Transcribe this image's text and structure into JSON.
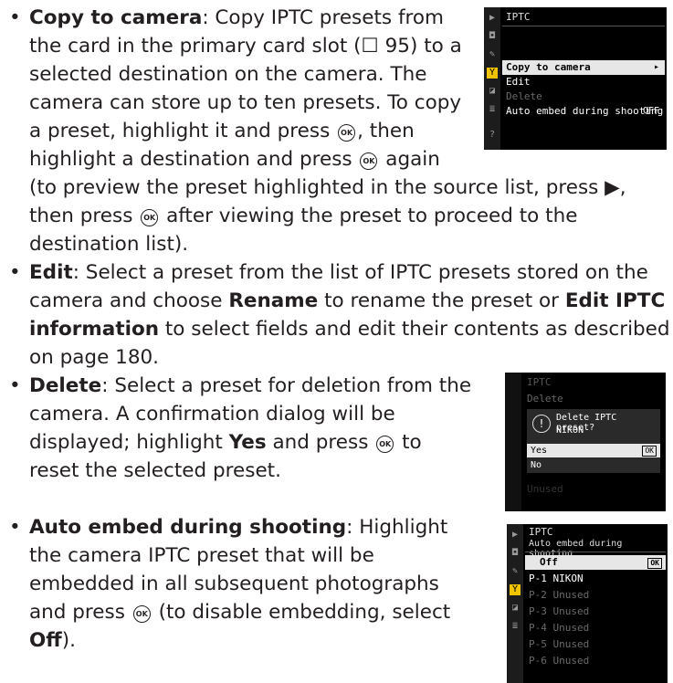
{
  "ok_glyph": "OK",
  "book_glyph": "☐",
  "item1": {
    "term": "Copy to camera",
    "lines": [
      "the card in the primary card slot (",
      " 95) to a",
      "selected destination on the camera. The",
      "camera can store up to ten presets.  To copy",
      "a preset, highlight it and press ",
      ", then",
      "highlight a destination and press ",
      " again",
      "(to preview the preset highlighted in the source list, press ▶,",
      "then press ",
      " after viewing the preset to proceed to the",
      "destination list)."
    ],
    "line1_rest": ": Copy IPTC presets from"
  },
  "item2": {
    "term": "Edit",
    "line1": ": Select a preset from the list of IPTC presets stored on the",
    "line2a": "camera and choose ",
    "rename": "Rename",
    "line2b": " to rename the preset or ",
    "edit_iptc": "Edit IPTC",
    "information": "information",
    "line3": " to select fields and edit their contents as described",
    "line4": "on page 180."
  },
  "item3": {
    "term": "Delete",
    "line1": ": Select a preset for deletion from the",
    "line2": "camera.  A confirmation dialog will be",
    "line3": "displayed; highlight ",
    "yes": "Yes",
    "line3b": " and press ",
    "line3c": " to",
    "line4": "reset the selected preset."
  },
  "item4": {
    "term": "Auto embed during shooting",
    "line1": ": Highlight",
    "line2": "the camera IPTC preset that will be",
    "line3": "embedded in all subsequent photographs",
    "line4": "and press ",
    "line4b": " (to disable embedding, select",
    "off": "Off",
    "line5": ")."
  },
  "screen1": {
    "title": "IPTC",
    "rows": [
      "Copy to camera",
      "Edit",
      "Delete",
      "Auto embed during shooting"
    ],
    "row4_value": "OFF",
    "arrow": "▸",
    "help": "?"
  },
  "screen2": {
    "title": "IPTC",
    "subtitle": "Delete",
    "question": "Delete IPTC preset?",
    "preset": "NIKON",
    "yes": "Yes",
    "no": "No",
    "faded": "Unused"
  },
  "screen3": {
    "title": "IPTC",
    "subtitle": "Auto embed during shooting",
    "off": "Off",
    "p1": "P-1 NIKON",
    "unused": [
      "P-2 Unused",
      "P-3 Unused",
      "P-4 Unused",
      "P-5 Unused",
      "P-6 Unused"
    ]
  }
}
